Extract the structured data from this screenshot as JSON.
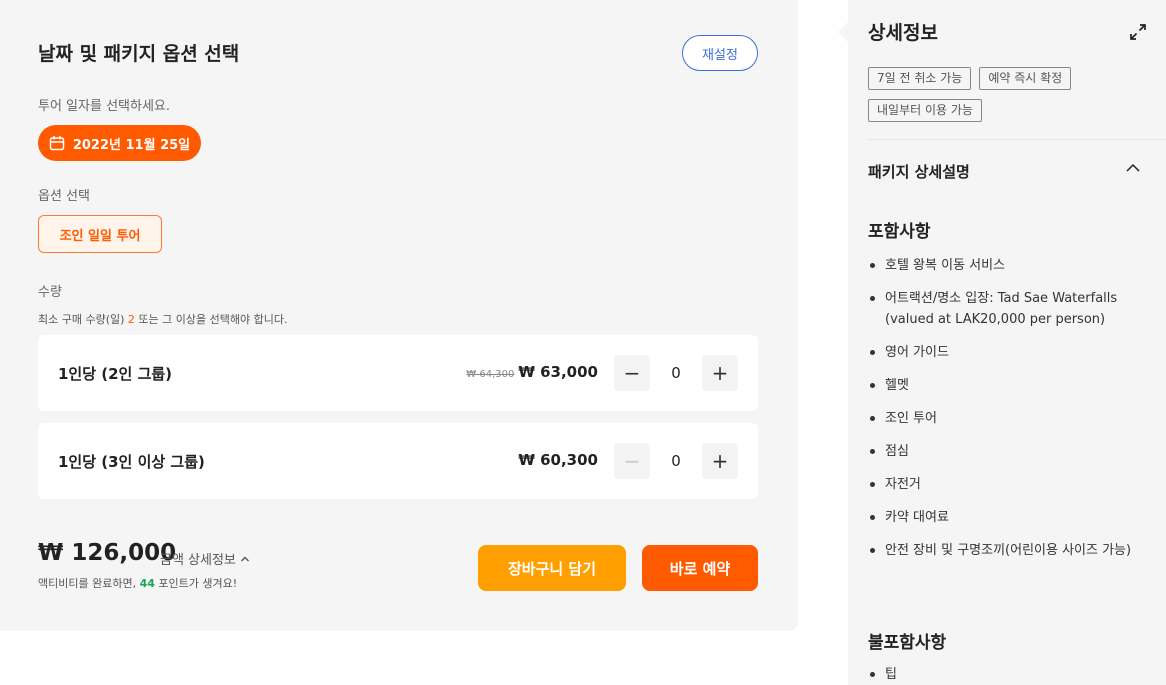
{
  "booking": {
    "title": "날짜 및 패키지 옵션 선택",
    "reset_label": "재설정",
    "date_prompt": "투어 일자를 선택하세요.",
    "selected_date": "2022년 11월 25일",
    "option_label": "옵션 선택",
    "selected_option": "조인 일일 투어",
    "quantity_label": "수량",
    "min_note_prefix": "최소 구매 수량(일) ",
    "min_note_count": "2",
    "min_note_suffix": " 또는 그 이상을 선택해야 합니다.",
    "rows": [
      {
        "label": "1인당 (2인 그룹)",
        "old_price": "₩ 64,300",
        "price": "₩ 63,000",
        "qty": "0",
        "minus": "−",
        "plus": "+"
      },
      {
        "label": "1인당 (3인 이상 그룹)",
        "old_price": "",
        "price": "₩ 60,300",
        "qty": "0",
        "minus": "−",
        "plus": "+"
      }
    ],
    "total": "₩ 126,000",
    "amount_detail": "금액 상세정보",
    "points_prefix": "액티비티를 완료하면, ",
    "points_value": "44",
    "points_suffix": " 포인트가 생겨요!",
    "cart_label": "장바구니 담기",
    "book_label": "바로 예약"
  },
  "details": {
    "title": "상세정보",
    "tags": [
      "7일 전 취소 가능",
      "예약 즉시 확정",
      "내일부터 이용 가능"
    ],
    "package_heading": "패키지 상세설명",
    "included_heading": "포함사항",
    "included": [
      "호텔 왕복 이동 서비스",
      "어트랙션/명소 입장: Tad Sae Waterfalls (valued at LAK20,000 per person)",
      "영어 가이드",
      "헬멧",
      "조인 투어",
      "점심",
      "자전거",
      "카약 대여료",
      "안전 장비 및 구명조끼(어린이용 사이즈 가능)"
    ],
    "excluded_heading": "불포함사항",
    "excluded": [
      "팁"
    ]
  },
  "icons": {
    "date": "calendar-icon",
    "expand": "expand-icon",
    "collapse": "chevron-up-icon",
    "amount_toggle": "chevron-up-icon"
  },
  "colors": {
    "primary": "#ff5a00",
    "secondary": "#ff9f00",
    "link": "#3b6fd8",
    "points": "#1aa55a"
  }
}
